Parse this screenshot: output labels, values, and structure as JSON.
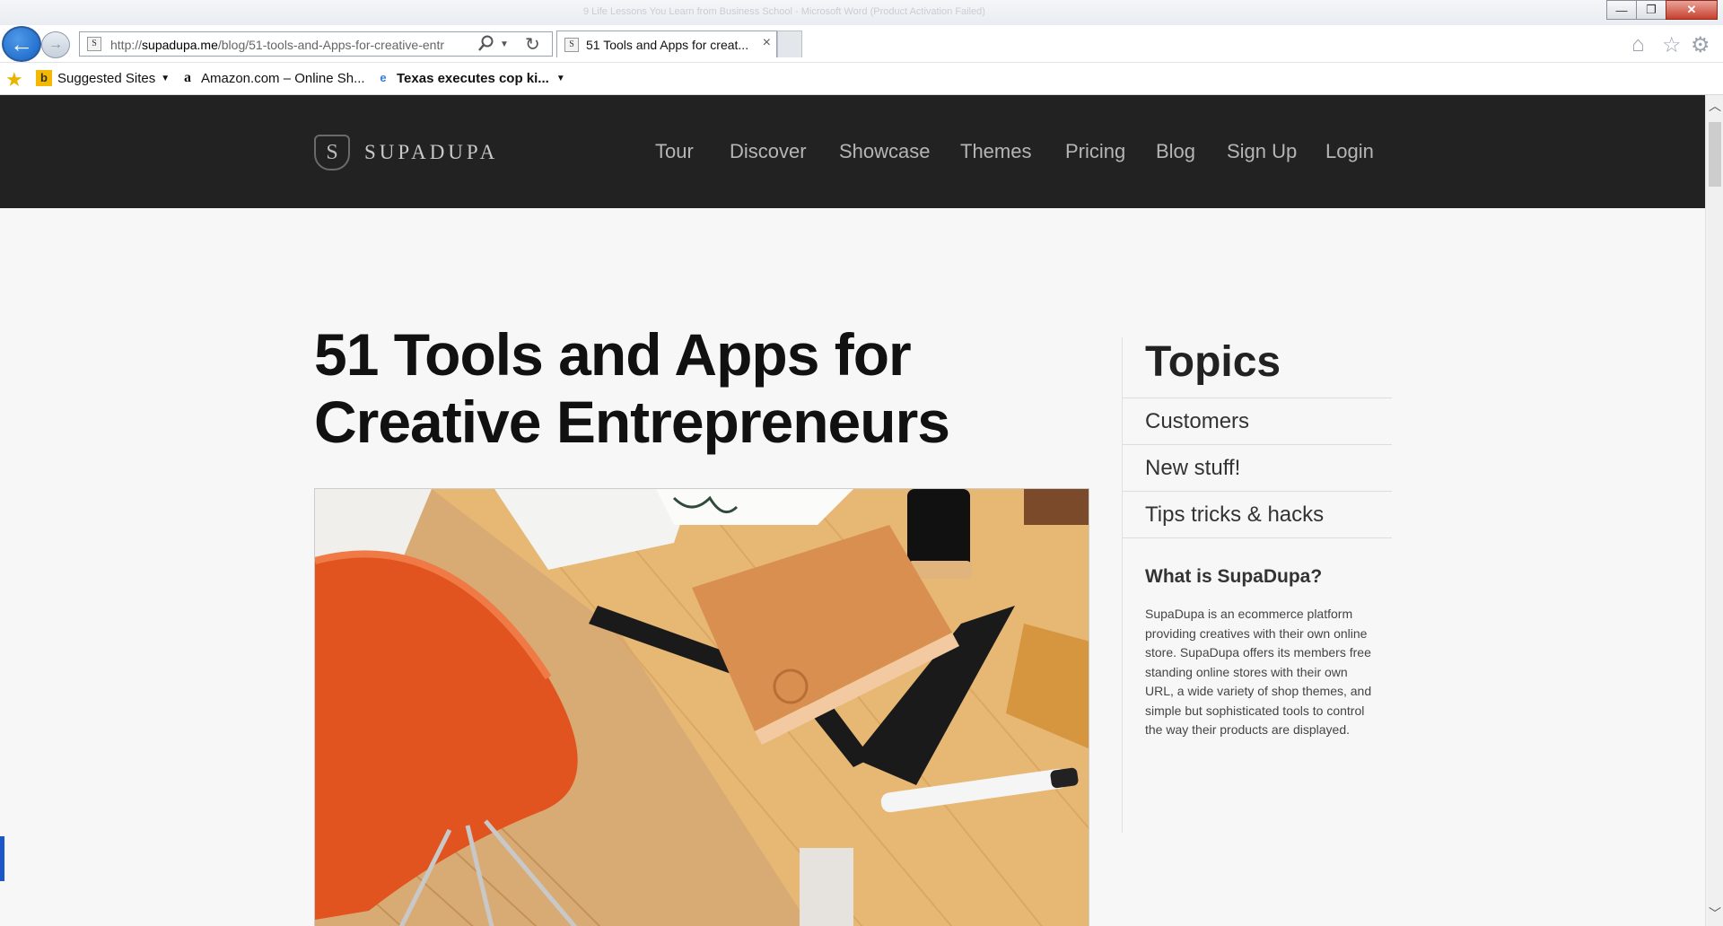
{
  "browser": {
    "window_title_ghost": "9 Life Lessons You Learn from Business School - Microsoft Word (Product Activation Failed)",
    "window_controls": {
      "minimize": "—",
      "restore": "❐",
      "close": "✕"
    },
    "back_glyph": "←",
    "forward_glyph": "→",
    "favicon_letter": "S",
    "address_prefix": "http://",
    "address_domain": "supadupa.me",
    "address_path": "/blog/51-tools-and-Apps-for-creative-entr",
    "tab_title": "51 Tools and Apps for creat...",
    "tab_close": "×",
    "favorites": [
      {
        "label": "Suggested Sites",
        "icon": "bing-icon"
      },
      {
        "label": "Amazon.com – Online Sh...",
        "icon": "amazon-icon"
      },
      {
        "label": "Texas executes cop ki...",
        "icon": "ie-page-icon"
      }
    ]
  },
  "site": {
    "logo_mark": "S",
    "logo_text": "SUPADUPA",
    "nav": [
      "Tour",
      "Discover",
      "Showcase",
      "Themes",
      "Pricing",
      "Blog",
      "Sign Up",
      "Login"
    ]
  },
  "post": {
    "title": "51 Tools and Apps for Creative Entrepreneurs",
    "hero_alt": "Wooden desk with leather notebook, rulers, marker and orange chair"
  },
  "sidebar": {
    "heading": "Topics",
    "topics": [
      "Customers",
      "New stuff!",
      "Tips tricks & hacks"
    ],
    "about_heading": "What is SupaDupa?",
    "about_text": "SupaDupa is an ecommerce platform providing creatives with their own online store. SupaDupa offers its members free standing online stores with their own URL, a wide variety of shop themes, and simple but sophisticated tools to control the way their products are displayed."
  },
  "colors": {
    "header_bg": "#222222",
    "page_bg": "#f7f7f7",
    "nav_text": "#b5b5b5",
    "ie_blue": "#1560c4"
  }
}
